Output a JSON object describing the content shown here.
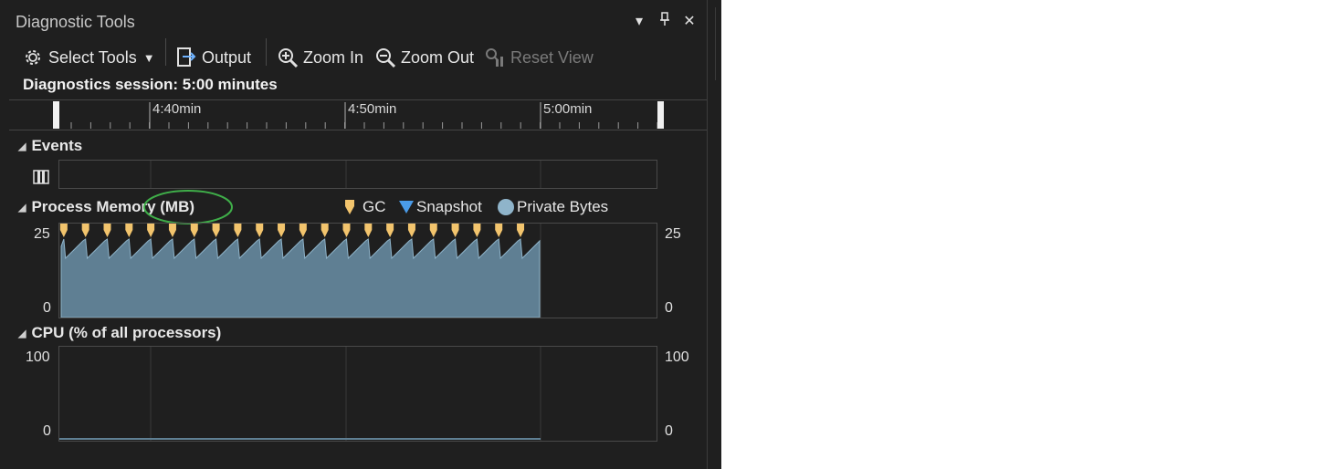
{
  "window": {
    "title": "Diagnostic Tools"
  },
  "toolbar": {
    "select_tools": "Select Tools",
    "output": "Output",
    "zoom_in": "Zoom In",
    "zoom_out": "Zoom Out",
    "reset_view": "Reset View"
  },
  "session": {
    "label": "Diagnostics session: 5:00 minutes"
  },
  "ruler": {
    "labels": [
      "4:40min",
      "4:50min",
      "5:00min"
    ]
  },
  "events": {
    "title": "Events"
  },
  "memory": {
    "title": "Process Memory (MB)",
    "legend": {
      "gc": "GC",
      "snapshot": "Snapshot",
      "private_bytes": "Private Bytes"
    },
    "y_max": "25",
    "y_min": "0",
    "gc_marker_count": 22
  },
  "cpu": {
    "title": "CPU (% of all processors)",
    "y_max": "100",
    "y_min": "0"
  },
  "colors": {
    "panel_bg": "#1f1f1f",
    "memory_fill": "#5f7f93",
    "gc_marker": "#f2c46d",
    "snapshot_marker": "#4a9be8",
    "private_bytes_dot": "#8fb4ca",
    "annotation_ellipse": "#3fae49"
  }
}
